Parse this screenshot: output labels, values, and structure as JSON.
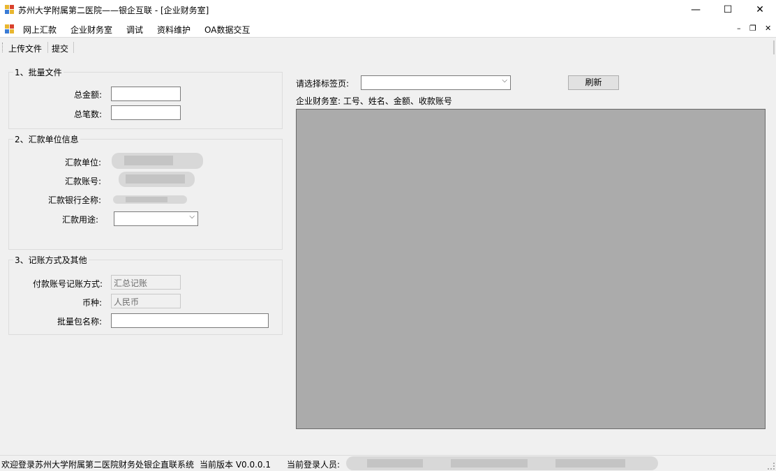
{
  "window": {
    "title": "苏州大学附属第二医院——银企互联 - [企业财务室]",
    "minimize_glyph": "—",
    "maximize_glyph": "☐",
    "close_glyph": "✕"
  },
  "menu": {
    "items": [
      "网上汇款",
      "企业财务室",
      "调试",
      "资料维护",
      "OA数据交互"
    ],
    "mdi_minimize": "–",
    "mdi_restore": "❐",
    "mdi_close": "✕"
  },
  "toolbar": {
    "upload_label": "上传文件",
    "submit_label": "提交"
  },
  "group1": {
    "title": "1、批量文件",
    "total_amount_label": "总金额:",
    "total_amount_value": "",
    "total_count_label": "总笔数:",
    "total_count_value": ""
  },
  "group2": {
    "title": "2、汇款单位信息",
    "remit_unit_label": "汇款单位:",
    "remit_account_label": "汇款账号:",
    "remit_bank_label": "汇款银行全称:",
    "purpose_label": "汇款用途:",
    "purpose_value": ""
  },
  "group3": {
    "title": "3、记账方式及其他",
    "posting_method_label": "付款账号记账方式:",
    "posting_method_value": "汇总记账",
    "currency_label": "币种:",
    "currency_value": "人民币",
    "batch_name_label": "批量包名称:",
    "batch_name_value": ""
  },
  "right": {
    "select_tab_label": "请选择标签页:",
    "select_tab_value": "",
    "refresh_label": "刷新",
    "hint": "企业财务室: 工号、姓名、金额、收款账号"
  },
  "status": {
    "welcome": "欢迎登录苏州大学附属第二医院财务处银企直联系统",
    "version": "当前版本 V0.0.0.1",
    "user_label": "当前登录人员:"
  },
  "colors": {
    "grid_background": "#ababab",
    "icon_colors": [
      "#e8b730",
      "#d9412b",
      "#3a7bd5",
      "#e8b730"
    ]
  }
}
